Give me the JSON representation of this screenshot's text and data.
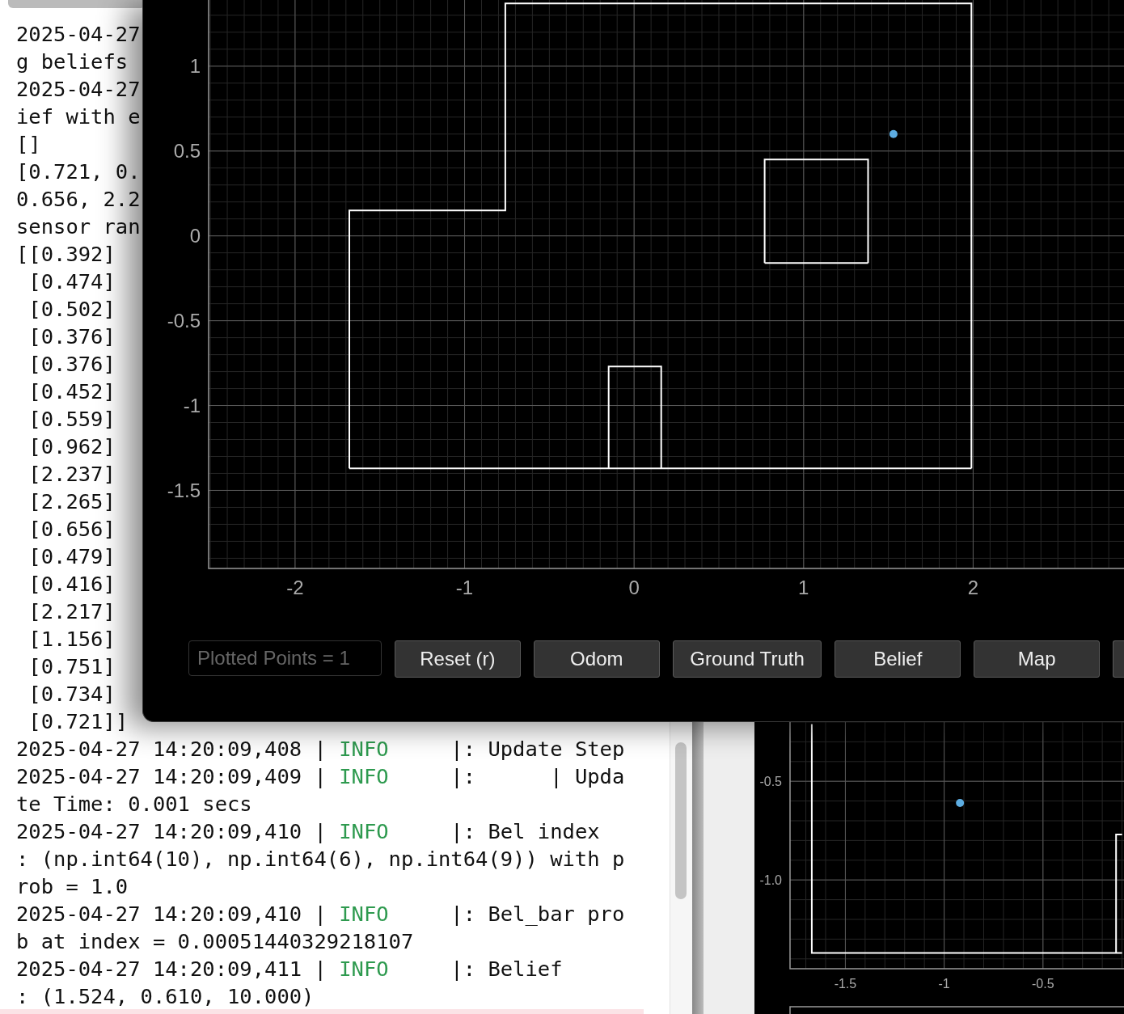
{
  "console": {
    "lines": [
      {
        "text": "2025-04-27"
      },
      {
        "text": "g beliefs"
      },
      {
        "text": "2025-04-27"
      },
      {
        "text": "ief with e"
      },
      {
        "text": "[]"
      },
      {
        "text": "[0.721, 0."
      },
      {
        "text": "0.656, 2.2"
      },
      {
        "text": "sensor ran"
      },
      {
        "text": "[[0.392]"
      },
      {
        "text": " [0.474]"
      },
      {
        "text": " [0.502]"
      },
      {
        "text": " [0.376]"
      },
      {
        "text": " [0.376]"
      },
      {
        "text": " [0.452]"
      },
      {
        "text": " [0.559]"
      },
      {
        "text": " [0.962]"
      },
      {
        "text": " [2.237]"
      },
      {
        "text": " [2.265]"
      },
      {
        "text": " [0.656]"
      },
      {
        "text": " [0.479]"
      },
      {
        "text": " [0.416]"
      },
      {
        "text": " [2.217]"
      },
      {
        "text": " [1.156]"
      },
      {
        "text": " [0.751]"
      },
      {
        "text": " [0.734]"
      },
      {
        "text": " [0.721]]"
      },
      {
        "time": "2025-04-27 14:20:09,408 |",
        "severity": "INFO",
        "message": "     |: Update Step"
      },
      {
        "time": "2025-04-27 14:20:09,409 |",
        "severity": "INFO",
        "message": "     |:      | Upda"
      },
      {
        "text": "te Time: 0.001 secs"
      },
      {
        "time": "2025-04-27 14:20:09,410 |",
        "severity": "INFO",
        "message": "     |: Bel index"
      },
      {
        "text": ": (np.int64(10), np.int64(6), np.int64(9)) with p"
      },
      {
        "text": "rob = 1.0"
      },
      {
        "time": "2025-04-27 14:20:09,410 |",
        "severity": "INFO",
        "message": "     |: Bel_bar pro"
      },
      {
        "text": "b at index = 0.00051440329218107"
      },
      {
        "time": "2025-04-27 14:20:09,411 |",
        "severity": "INFO",
        "message": "     |: Belief"
      },
      {
        "text": ": (1.524, 0.610, 10.000)"
      }
    ]
  },
  "plotter_window": {
    "plot": {
      "chart_data": {
        "type": "line",
        "grid": true,
        "xlim": [
          -2.51,
          2.89
        ],
        "ylim": [
          -1.96,
          1.39
        ],
        "xticks": [
          -2,
          -1,
          0,
          1,
          2
        ],
        "yticks": [
          -1.5,
          -1,
          -0.5,
          0,
          0.5,
          1
        ],
        "x": [
          -1.68,
          -1.68,
          -0.76,
          -0.76,
          1.99,
          1.99,
          -1.68,
          1.99,
          0.77,
          0.77,
          1.38,
          1.38,
          0.77,
          1.38,
          -0.15,
          -0.15,
          0.16,
          0.16,
          1.53
        ],
        "series": [
          {
            "color": "#ffffff",
            "values": [
              -1.37,
              0.15,
              0.15,
              1.37,
              1.37,
              -1.37,
              null,
              null,
              null,
              null,
              null,
              null,
              null,
              null,
              null,
              null,
              null,
              null,
              null
            ]
          },
          {
            "color": "#ffffff",
            "values": [
              null,
              null,
              null,
              null,
              null,
              null,
              -1.37,
              -1.37,
              null,
              null,
              null,
              null,
              null,
              null,
              null,
              null,
              null,
              null,
              null
            ]
          },
          {
            "color": "#ffffff",
            "values": [
              null,
              null,
              null,
              null,
              null,
              null,
              null,
              null,
              -0.16,
              0.45,
              0.45,
              -0.16,
              null,
              null,
              null,
              null,
              null,
              null,
              null
            ]
          },
          {
            "color": "#ffffff",
            "values": [
              null,
              null,
              null,
              null,
              null,
              null,
              null,
              null,
              null,
              null,
              null,
              null,
              -0.16,
              -0.16,
              null,
              null,
              null,
              null,
              null
            ]
          },
          {
            "color": "#ffffff",
            "values": [
              null,
              null,
              null,
              null,
              null,
              null,
              null,
              null,
              null,
              null,
              null,
              null,
              null,
              null,
              -1.37,
              -0.77,
              -0.77,
              -1.37,
              null
            ]
          },
          {
            "color": "#5dade2",
            "marker": "circle",
            "values": [
              null,
              null,
              null,
              null,
              null,
              null,
              null,
              null,
              null,
              null,
              null,
              null,
              null,
              null,
              null,
              null,
              null,
              null,
              0.6
            ]
          }
        ]
      }
    },
    "points_field": {
      "value": "Plotted Points = 1"
    },
    "buttons": [
      {
        "label": "Reset (r)"
      },
      {
        "label": "Odom"
      },
      {
        "label": "Ground Truth"
      },
      {
        "label": "Belief"
      },
      {
        "label": "Map"
      }
    ]
  },
  "side_plot": {
    "chart_data": {
      "type": "line",
      "grid": true,
      "xlim": [
        -1.78,
        -0.09
      ],
      "ylim": [
        -1.45,
        -0.2
      ],
      "xticks": [
        -1.5,
        -1,
        -0.5
      ],
      "yticks": [
        {
          "value": -0.5,
          "label": "-0.5"
        },
        {
          "value": -1,
          "label": "-1.0"
        }
      ],
      "x": [
        -1.67,
        -1.67,
        -0.1,
        -0.13,
        -0.13,
        -0.1,
        -0.92
      ],
      "series": [
        {
          "color": "#ffffff",
          "values": [
            -0.21,
            -1.37,
            -1.37,
            null,
            null,
            null,
            null
          ]
        },
        {
          "color": "#ffffff",
          "values": [
            null,
            null,
            null,
            -1.37,
            -0.77,
            -0.77,
            null
          ]
        },
        {
          "color": "#5dade2",
          "marker": "circle",
          "values": [
            null,
            null,
            null,
            null,
            null,
            null,
            -0.61
          ]
        }
      ]
    }
  }
}
